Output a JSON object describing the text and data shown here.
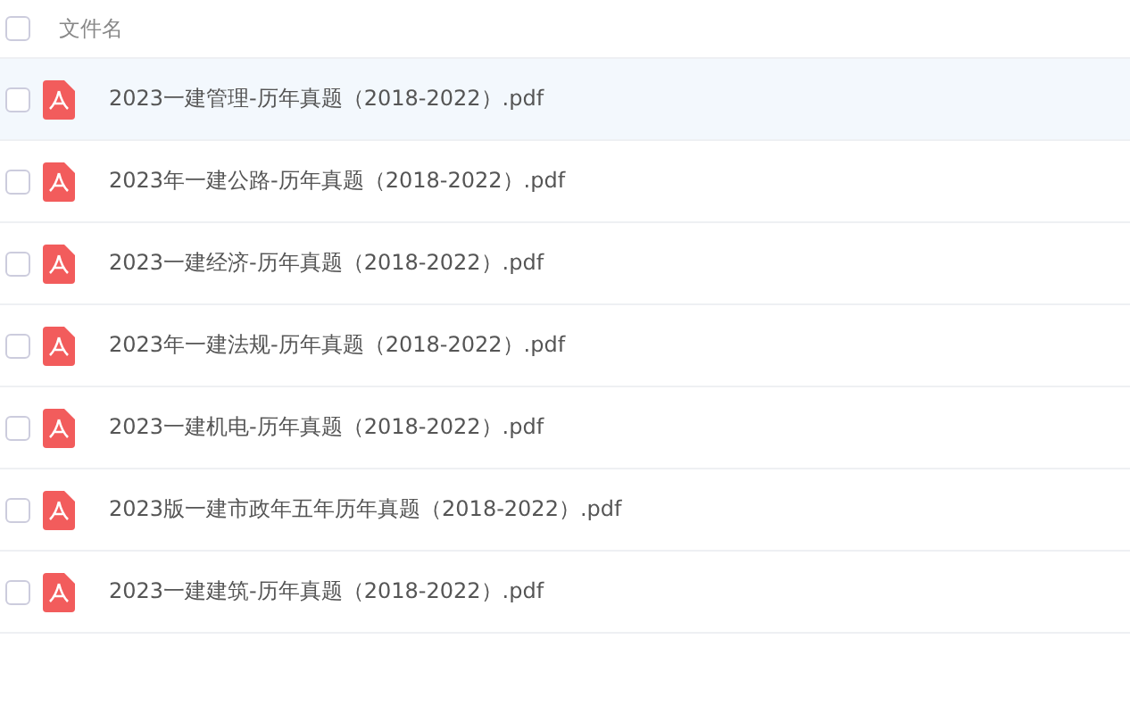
{
  "table": {
    "select_all": {
      "checked": false
    },
    "columns": [
      {
        "label": "文件名"
      }
    ],
    "rows": [
      {
        "name": "2023一建管理-历年真题（2018-2022）.pdf",
        "selected": true,
        "checked": false
      },
      {
        "name": "2023年一建公路-历年真题（2018-2022）.pdf",
        "selected": false,
        "checked": false
      },
      {
        "name": "2023一建经济-历年真题（2018-2022）.pdf",
        "selected": false,
        "checked": false
      },
      {
        "name": "2023年一建法规-历年真题（2018-2022）.pdf",
        "selected": false,
        "checked": false
      },
      {
        "name": "2023一建机电-历年真题（2018-2022）.pdf",
        "selected": false,
        "checked": false
      },
      {
        "name": "2023版一建市政年五年历年真题（2018-2022）.pdf",
        "selected": false,
        "checked": false
      },
      {
        "name": "2023一建建筑-历年真题（2018-2022）.pdf",
        "selected": false,
        "checked": false
      }
    ]
  }
}
